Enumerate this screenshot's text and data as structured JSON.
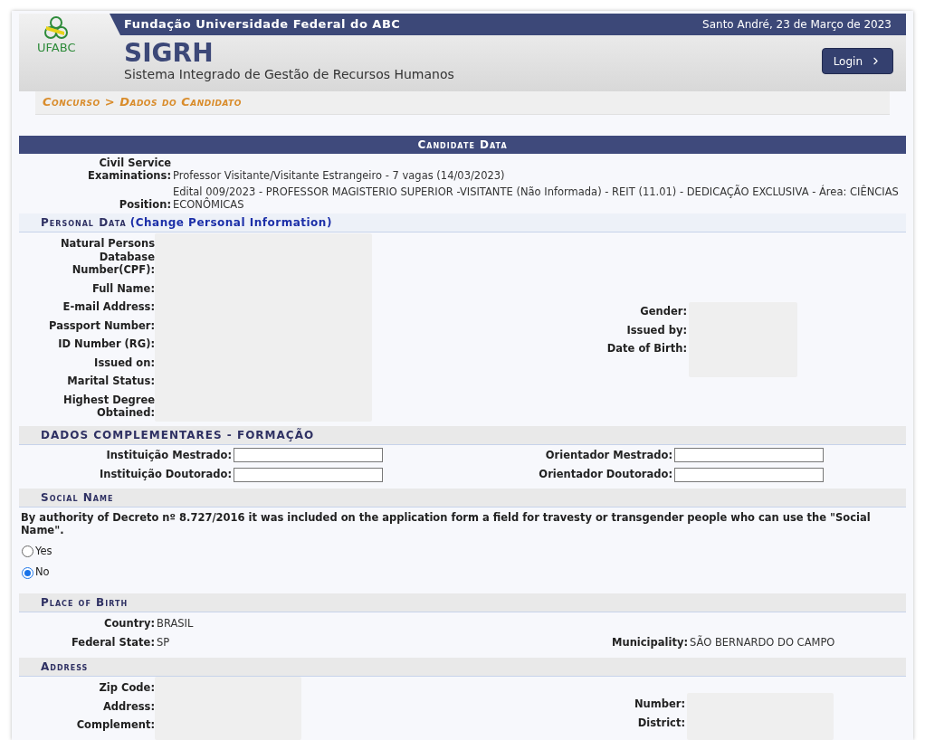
{
  "header": {
    "organization": "Fundação Universidade Federal do ABC",
    "date": "Santo André, 23 de Março de 2023",
    "logo_text": "UFABC",
    "app_name": "SIGRH",
    "app_subtitle": "Sistema Integrado de Gestão de Recursos Humanos",
    "login_button": "Login"
  },
  "breadcrumb": "Concurso > Dados do Candidato",
  "candidate_data": {
    "title": "Candidate Data",
    "fields": [
      {
        "label": "Civil Service Examinations:",
        "value": "Professor Visitante/Visitante Estrangeiro - 7 vagas (14/03/2023)"
      },
      {
        "label": "Position:",
        "value": "Edital 009/2023 - PROFESSOR MAGISTERIO SUPERIOR -VISITANTE (Não Informada) - REIT (11.01) - DEDICAÇÃO EXCLUSIVA - Área: CIÊNCIAS ECONÔMICAS"
      }
    ]
  },
  "personal_data": {
    "title": "Personal Data",
    "link": "(Change Personal Information)",
    "left_labels": [
      "Natural Persons Database Number(CPF):",
      "Full Name:",
      "E-mail Address:",
      "Passport Number:",
      "ID Number (RG):",
      "Issued on:",
      "Marital Status:",
      "Highest Degree Obtained:"
    ],
    "right_labels": [
      "Gender:",
      "Issued by:",
      "Date of Birth:"
    ]
  },
  "complementary": {
    "title": "DADOS COMPLEMENTARES - FORMAÇÃO",
    "rows": [
      {
        "left_label": "Instituição Mestrado:",
        "right_label": "Orientador Mestrado:"
      },
      {
        "left_label": "Instituição Doutorado:",
        "right_label": "Orientador Doutorado:"
      }
    ]
  },
  "social_name": {
    "title": "Social Name",
    "text": "By authority of Decreto nº 8.727/2016 it was included on the application form a field for travesty or transgender people who can use the \"Social Name\".",
    "options": [
      {
        "label": "Yes",
        "selected": false
      },
      {
        "label": "No",
        "selected": true
      }
    ]
  },
  "place_of_birth": {
    "title": "Place of Birth",
    "rows": [
      {
        "left_label": "Country:",
        "left_value": "BRASIL"
      },
      {
        "left_label": "Federal State:",
        "left_value": "SP",
        "right_label": "Municipality:",
        "right_value": "SÃO BERNARDO DO CAMPO"
      }
    ]
  },
  "address": {
    "title": "Address",
    "left_labels": [
      "Zip Code:",
      "Address:",
      "Complement:"
    ],
    "right_labels": [
      "Number:",
      "District:"
    ]
  }
}
